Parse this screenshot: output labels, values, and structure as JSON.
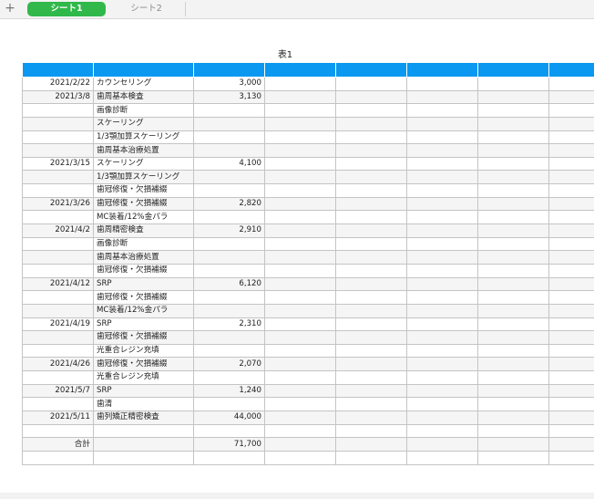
{
  "tabbar": {
    "add_label": "+",
    "tabs": [
      {
        "label": "シート1",
        "active": true
      },
      {
        "label": "シート2",
        "active": false
      }
    ]
  },
  "table": {
    "title": "表1",
    "header_color": "#0a98f0",
    "column_count": 8,
    "rows": [
      [
        "2021/2/22",
        "カウンセリング",
        "3,000"
      ],
      [
        "2021/3/8",
        "歯周基本検査",
        "3,130"
      ],
      [
        "",
        "画像診断",
        ""
      ],
      [
        "",
        "スケーリング",
        ""
      ],
      [
        "",
        "1/3顎加算スケーリング",
        ""
      ],
      [
        "",
        "歯周基本治療処置",
        ""
      ],
      [
        "2021/3/15",
        "スケーリング",
        "4,100"
      ],
      [
        "",
        "1/3顎加算スケーリング",
        ""
      ],
      [
        "",
        "歯冠修復・欠損補綴",
        ""
      ],
      [
        "2021/3/26",
        "歯冠修復・欠損補綴",
        "2,820"
      ],
      [
        "",
        "MC装着/12%金パラ",
        ""
      ],
      [
        "2021/4/2",
        "歯周精密検査",
        "2,910"
      ],
      [
        "",
        "画像診断",
        ""
      ],
      [
        "",
        "歯周基本治療処置",
        ""
      ],
      [
        "",
        "歯冠修復・欠損補綴",
        ""
      ],
      [
        "2021/4/12",
        "SRP",
        "6,120"
      ],
      [
        "",
        "歯冠修復・欠損補綴",
        ""
      ],
      [
        "",
        "MC装着/12%金パラ",
        ""
      ],
      [
        "2021/4/19",
        "SRP",
        "2,310"
      ],
      [
        "",
        "歯冠修復・欠損補綴",
        ""
      ],
      [
        "",
        "光重合レジン充填",
        ""
      ],
      [
        "2021/4/26",
        "歯冠修復・欠損補綴",
        "2,070"
      ],
      [
        "",
        "光重合レジン充填",
        ""
      ],
      [
        "2021/5/7",
        "SRP",
        "1,240"
      ],
      [
        "",
        "歯清",
        ""
      ],
      [
        "2021/5/11",
        "歯列矯正精密検査",
        "44,000"
      ],
      [
        "",
        "",
        ""
      ],
      [
        "合計",
        "",
        "71,700"
      ],
      [
        "",
        "",
        ""
      ]
    ]
  }
}
